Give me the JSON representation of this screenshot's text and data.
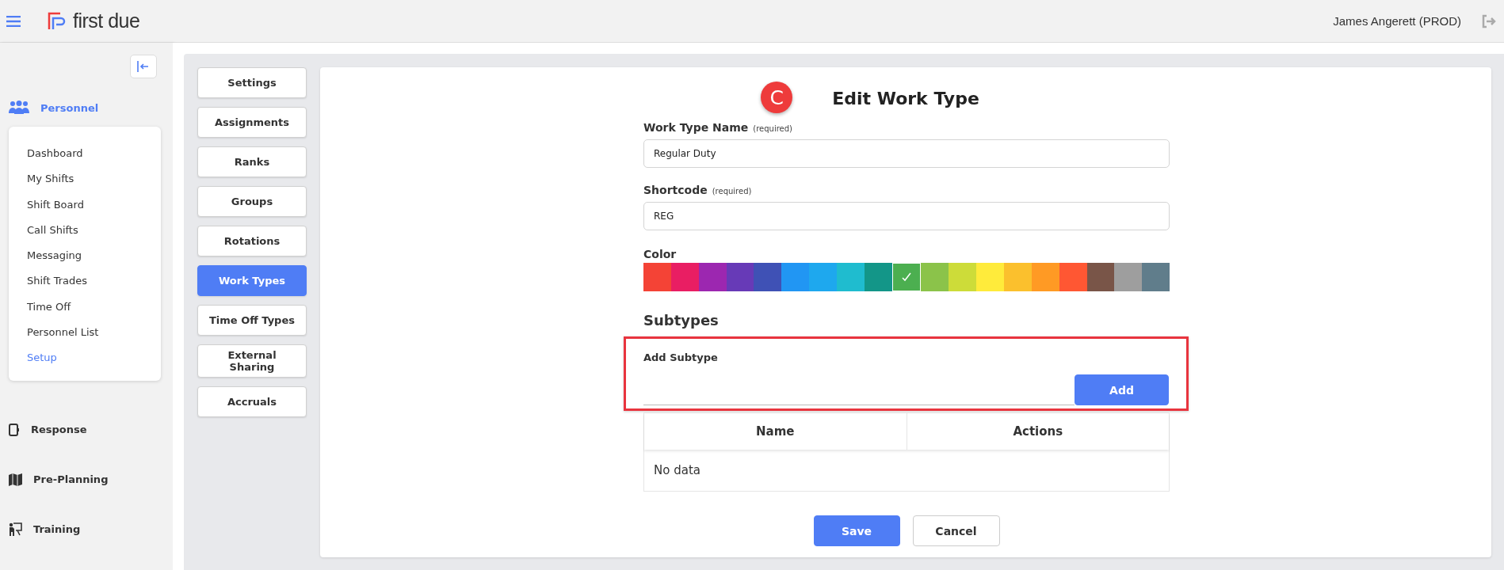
{
  "header": {
    "brand": "first due",
    "user": "James Angerett (PROD)"
  },
  "sidebar": {
    "sections": [
      {
        "label": "Personnel",
        "selected": true,
        "items": [
          {
            "label": "Dashboard",
            "selected": false
          },
          {
            "label": "My Shifts",
            "selected": false
          },
          {
            "label": "Shift Board",
            "selected": false
          },
          {
            "label": "Call Shifts",
            "selected": false
          },
          {
            "label": "Messaging",
            "selected": false
          },
          {
            "label": "Shift Trades",
            "selected": false
          },
          {
            "label": "Time Off",
            "selected": false
          },
          {
            "label": "Personnel List",
            "selected": false
          },
          {
            "label": "Setup",
            "selected": true
          }
        ]
      },
      {
        "label": "Response",
        "selected": false
      },
      {
        "label": "Pre-Planning",
        "selected": false
      },
      {
        "label": "Training",
        "selected": false
      }
    ]
  },
  "setup_tabs": [
    {
      "label": "Settings",
      "selected": false
    },
    {
      "label": "Assignments",
      "selected": false
    },
    {
      "label": "Ranks",
      "selected": false
    },
    {
      "label": "Groups",
      "selected": false
    },
    {
      "label": "Rotations",
      "selected": false
    },
    {
      "label": "Work Types",
      "selected": true
    },
    {
      "label": "Time Off Types",
      "selected": false
    },
    {
      "label": "External Sharing",
      "selected": false
    },
    {
      "label": "Accruals",
      "selected": false
    }
  ],
  "form": {
    "marker": "C",
    "title": "Edit Work Type",
    "fields": [
      {
        "label": "Work Type Name",
        "hint": "(required)",
        "value": "Regular Duty"
      },
      {
        "label": "Shortcode",
        "hint": "(required)",
        "value": "REG"
      }
    ],
    "color_label": "Color",
    "colors": [
      {
        "color": "#f44336",
        "selected": false
      },
      {
        "color": "#e91e63",
        "selected": false
      },
      {
        "color": "#9c27b0",
        "selected": false
      },
      {
        "color": "#673ab7",
        "selected": false
      },
      {
        "color": "#3f51b5",
        "selected": false
      },
      {
        "color": "#2196f3",
        "selected": false
      },
      {
        "color": "#1ea8ee",
        "selected": false
      },
      {
        "color": "#1fbccf",
        "selected": false
      },
      {
        "color": "#139688",
        "selected": false
      },
      {
        "color": "#4caf50",
        "selected": true
      },
      {
        "color": "#8bc34a",
        "selected": false
      },
      {
        "color": "#cddc39",
        "selected": false
      },
      {
        "color": "#ffeb3b",
        "selected": false
      },
      {
        "color": "#fbc02d",
        "selected": false
      },
      {
        "color": "#ff9a24",
        "selected": false
      },
      {
        "color": "#ff5733",
        "selected": false
      },
      {
        "color": "#795548",
        "selected": false
      },
      {
        "color": "#9e9e9e",
        "selected": false
      },
      {
        "color": "#607d8b",
        "selected": false
      }
    ],
    "subtypes_heading": "Subtypes",
    "add_subtype": {
      "label": "Add Subtype",
      "button": "Add"
    },
    "table": {
      "columns": [
        "Name",
        "Actions"
      ],
      "empty": "No data"
    },
    "buttons": [
      {
        "label": "Save",
        "kind": "primary"
      },
      {
        "label": "Cancel",
        "kind": "secondary"
      }
    ]
  }
}
